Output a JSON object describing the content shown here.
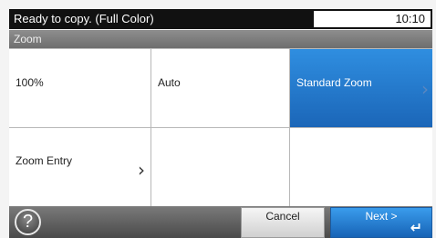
{
  "status": {
    "message": "Ready to copy. (Full Color)",
    "time": "10:10"
  },
  "title": "Zoom",
  "options": {
    "percent_100": "100%",
    "auto": "Auto",
    "standard_zoom": "Standard Zoom",
    "zoom_entry": "Zoom Entry"
  },
  "icons": {
    "help": "help-icon",
    "chevron": "chevron-right-icon",
    "enter": "enter-icon"
  },
  "footer": {
    "help_symbol": "?",
    "cancel_label": "Cancel",
    "next_label": "Next >",
    "enter_symbol": "↵"
  },
  "colors": {
    "selected": "#1f6fc4",
    "status_bar": "#111111",
    "title_bar": "#7e7e7e"
  }
}
